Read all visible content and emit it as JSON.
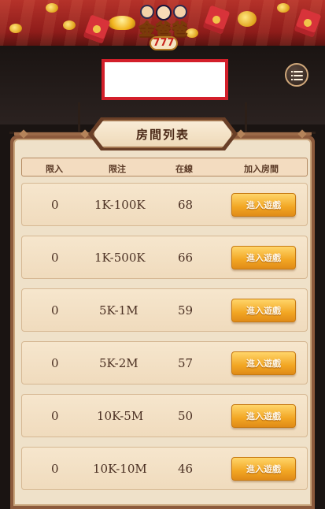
{
  "header": {
    "logo_icon": "jinbaba-777-logo"
  },
  "menu": {
    "icon": "list-menu-icon"
  },
  "room_list": {
    "title": "房間列表",
    "columns": [
      "限入",
      "限注",
      "在線",
      "加入房間"
    ],
    "rows": [
      {
        "min_entry": "0",
        "bet_limit": "1K-100K",
        "online": "68",
        "join_label": "進入遊戲"
      },
      {
        "min_entry": "0",
        "bet_limit": "1K-500K",
        "online": "66",
        "join_label": "進入遊戲"
      },
      {
        "min_entry": "0",
        "bet_limit": "5K-1M",
        "online": "59",
        "join_label": "進入遊戲"
      },
      {
        "min_entry": "0",
        "bet_limit": "5K-2M",
        "online": "57",
        "join_label": "進入遊戲"
      },
      {
        "min_entry": "0",
        "bet_limit": "10K-5M",
        "online": "50",
        "join_label": "進入遊戲"
      },
      {
        "min_entry": "0",
        "bet_limit": "10K-10M",
        "online": "46",
        "join_label": "進入遊戲"
      }
    ]
  },
  "colors": {
    "banner": "#8e1c1a",
    "panel_bg": "#efe1c9",
    "button": "#f2a623",
    "redaction_border": "#d31f2a"
  }
}
